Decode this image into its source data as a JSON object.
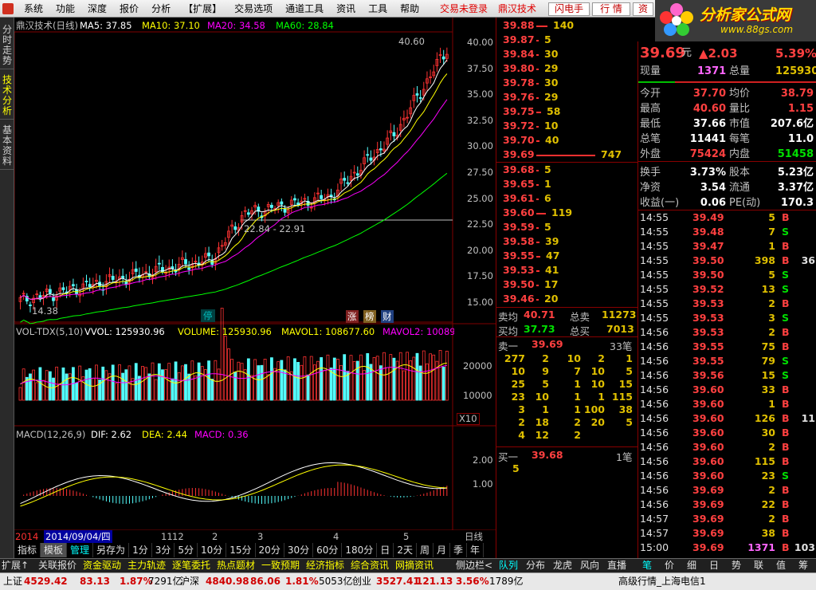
{
  "menu": {
    "items": [
      "系统",
      "功能",
      "深度",
      "报价",
      "分析",
      "【扩展】",
      "交易选项",
      "通道工具",
      "资讯",
      "工具",
      "帮助"
    ],
    "login": "交易未登录",
    "stock": "鼎汉技术",
    "btn_phone": "闪电手",
    "btn_quote": "行 情",
    "btn_info": "资"
  },
  "logo": {
    "title": "分析家公式网",
    "url": "www.88gs.com"
  },
  "side_tabs": [
    "分时走势",
    "技术分析",
    "基本资料"
  ],
  "main_chart": {
    "title": "鼎汉技术(日线)",
    "ma5": "MA5: 37.85",
    "ma10": "MA10: 37.10",
    "ma20": "MA20: 34.58",
    "ma60": "MA60: 28.84",
    "high_label": "40.60",
    "low_label": "14.38",
    "range_label": "22.84 - 22.91",
    "price_ticks": [
      "40.00",
      "37.50",
      "35.00",
      "32.50",
      "30.00",
      "27.50",
      "25.00",
      "22.50",
      "20.00",
      "17.50",
      "15.00"
    ],
    "marker_stop": "停",
    "marker_zhang": "涨",
    "marker_bang": "榜",
    "marker_cai": "财",
    "colors": {
      "ma5": "#ffffff",
      "ma10": "#ffff00",
      "ma20": "#ff00ff",
      "ma60": "#00ff00",
      "up": "#ff3232",
      "down": "#54ffff"
    }
  },
  "vol_chart": {
    "title": "VOL-TDX(5,10)",
    "vvol": "VVOL: 125930.96",
    "volume": "VOLUME: 125930.96",
    "mavol1": "MAVOL1: 108677.60",
    "mavol2": "MAVOL2: 10089",
    "ticks": [
      "20000",
      "10000"
    ],
    "unit": "X10"
  },
  "macd_chart": {
    "title": "MACD(12,26,9)",
    "dif": "DIF: 2.62",
    "dea": "DEA: 2.44",
    "macd": "MACD: 0.36",
    "ticks": [
      "2.00",
      "1.00"
    ]
  },
  "time_axis": {
    "year": "2014",
    "date": "2014/09/04/四",
    "months": [
      "11",
      "12",
      "2",
      "3",
      "4",
      "5"
    ],
    "period": "日线"
  },
  "toolbar": {
    "items": [
      "指标",
      "模板",
      "管理",
      "另存为",
      "1分",
      "3分",
      "5分",
      "10分",
      "15分",
      "20分",
      "30分",
      "60分",
      "180分",
      "日",
      "2天",
      "周",
      "月",
      "季",
      "年"
    ]
  },
  "asks": [
    {
      "price": "39.88",
      "vol": "140"
    },
    {
      "price": "39.87",
      "vol": "5"
    },
    {
      "price": "39.84",
      "vol": "30"
    },
    {
      "price": "39.80",
      "vol": "29"
    },
    {
      "price": "39.78",
      "vol": "30"
    },
    {
      "price": "39.76",
      "vol": "29"
    },
    {
      "price": "39.75",
      "vol": "58"
    },
    {
      "price": "39.72",
      "vol": "10"
    },
    {
      "price": "39.70",
      "vol": "40"
    },
    {
      "price": "39.69",
      "vol": "747"
    }
  ],
  "bids": [
    {
      "price": "39.68",
      "vol": "5"
    },
    {
      "price": "39.65",
      "vol": "1"
    },
    {
      "price": "39.61",
      "vol": "6"
    },
    {
      "price": "39.60",
      "vol": "119"
    },
    {
      "price": "39.59",
      "vol": "5"
    },
    {
      "price": "39.58",
      "vol": "39"
    },
    {
      "price": "39.55",
      "vol": "47"
    },
    {
      "price": "39.53",
      "vol": "41"
    },
    {
      "price": "39.50",
      "vol": "17"
    },
    {
      "price": "39.46",
      "vol": "20"
    }
  ],
  "summary": {
    "sell_avg_label": "卖均",
    "sell_avg": "40.71",
    "sell_total_label": "总卖",
    "sell_total": "11273",
    "buy_avg_label": "买均",
    "buy_avg": "37.73",
    "buy_total_label": "总买",
    "buy_total": "7013"
  },
  "queue": {
    "sell1_label": "卖一",
    "sell1_price": "39.69",
    "sell1_count": "33笔",
    "sell_rows": [
      [
        "277",
        "2",
        "10",
        "2",
        "1"
      ],
      [
        "10",
        "9",
        "7",
        "10",
        "5"
      ],
      [
        "25",
        "5",
        "1",
        "10",
        "15"
      ],
      [
        "23",
        "10",
        "1",
        "1",
        "115"
      ],
      [
        "3",
        "1",
        "1",
        "100",
        "38"
      ],
      [
        "2",
        "18",
        "2",
        "20",
        "5"
      ],
      [
        "4",
        "12",
        "2",
        "",
        ""
      ]
    ],
    "buy1_label": "买一",
    "buy1_price": "39.68",
    "buy1_count": "1笔",
    "buy_rows": [
      [
        "5"
      ]
    ]
  },
  "stock": {
    "price": "39.69",
    "unit": "元",
    "change": "▲2.03",
    "pct": "5.39%",
    "now_label": "现量",
    "now": "1371",
    "total_label": "总量",
    "total": "125930"
  },
  "stats": [
    [
      "今开",
      "37.70",
      "均价",
      "38.79"
    ],
    [
      "最高",
      "40.60",
      "量比",
      "1.15"
    ],
    [
      "最低",
      "37.66",
      "市值",
      "207.6亿"
    ],
    [
      "总笔",
      "11441",
      "每笔",
      "11.0"
    ],
    [
      "外盘",
      "75424",
      "内盘",
      "51458"
    ],
    [
      "换手",
      "3.73%",
      "股本",
      "5.23亿"
    ],
    [
      "净资",
      "3.54",
      "流通",
      "3.37亿"
    ],
    [
      "收益(一)",
      "0.06",
      "PE(动)",
      "170.3"
    ]
  ],
  "ticks": [
    [
      "14:55",
      "39.49",
      "5",
      "B",
      ""
    ],
    [
      "14:55",
      "39.48",
      "7",
      "S",
      ""
    ],
    [
      "14:55",
      "39.47",
      "1",
      "B",
      ""
    ],
    [
      "14:55",
      "39.50",
      "398",
      "B",
      "36"
    ],
    [
      "14:55",
      "39.50",
      "5",
      "S",
      ""
    ],
    [
      "14:55",
      "39.52",
      "13",
      "S",
      ""
    ],
    [
      "14:55",
      "39.53",
      "2",
      "B",
      ""
    ],
    [
      "14:55",
      "39.53",
      "3",
      "S",
      ""
    ],
    [
      "14:56",
      "39.53",
      "2",
      "B",
      ""
    ],
    [
      "14:56",
      "39.55",
      "75",
      "B",
      ""
    ],
    [
      "14:56",
      "39.55",
      "79",
      "S",
      ""
    ],
    [
      "14:56",
      "39.56",
      "15",
      "S",
      ""
    ],
    [
      "14:56",
      "39.60",
      "33",
      "B",
      ""
    ],
    [
      "14:56",
      "39.60",
      "1",
      "B",
      ""
    ],
    [
      "14:56",
      "39.60",
      "126",
      "B",
      "11"
    ],
    [
      "14:56",
      "39.60",
      "30",
      "B",
      ""
    ],
    [
      "14:56",
      "39.60",
      "2",
      "B",
      ""
    ],
    [
      "14:56",
      "39.60",
      "115",
      "B",
      ""
    ],
    [
      "14:56",
      "39.60",
      "23",
      "S",
      ""
    ],
    [
      "14:56",
      "39.69",
      "2",
      "B",
      ""
    ],
    [
      "14:56",
      "39.69",
      "22",
      "B",
      ""
    ],
    [
      "14:57",
      "39.69",
      "2",
      "B",
      ""
    ],
    [
      "14:57",
      "39.69",
      "38",
      "B",
      ""
    ],
    [
      "15:00",
      "39.69",
      "1371",
      "B",
      "103"
    ]
  ],
  "bottom_tabs": {
    "left": [
      "扩展↑",
      "关联报价",
      "资金驱动",
      "主力轨迹",
      "逐笔委托",
      "热点题材",
      "一致预期",
      "经济指标",
      "综合资讯",
      "网摘资讯"
    ],
    "side": "侧边栏<",
    "quote_tabs": [
      "队列",
      "分布",
      "龙虎",
      "风向",
      "直播"
    ],
    "info_tabs": [
      "笔",
      "价",
      "细",
      "日",
      "势",
      "联",
      "值",
      "筹"
    ]
  },
  "status": {
    "sh_label": "上证",
    "sh": "4529.42",
    "sh_chg": "83.13",
    "sh_pct": "1.87%",
    "sh_amt": "7291亿",
    "hs_label": "沪深",
    "hs": "4840.98",
    "hs_chg": "86.06",
    "hs_pct": "1.81%",
    "hs_amt": "5053亿",
    "cy_label": "创业",
    "cy": "3527.41",
    "cy_chg": "121.13",
    "cy_pct": "3.56%",
    "cy_amt": "1789亿",
    "feed": "高级行情_上海电信1"
  }
}
